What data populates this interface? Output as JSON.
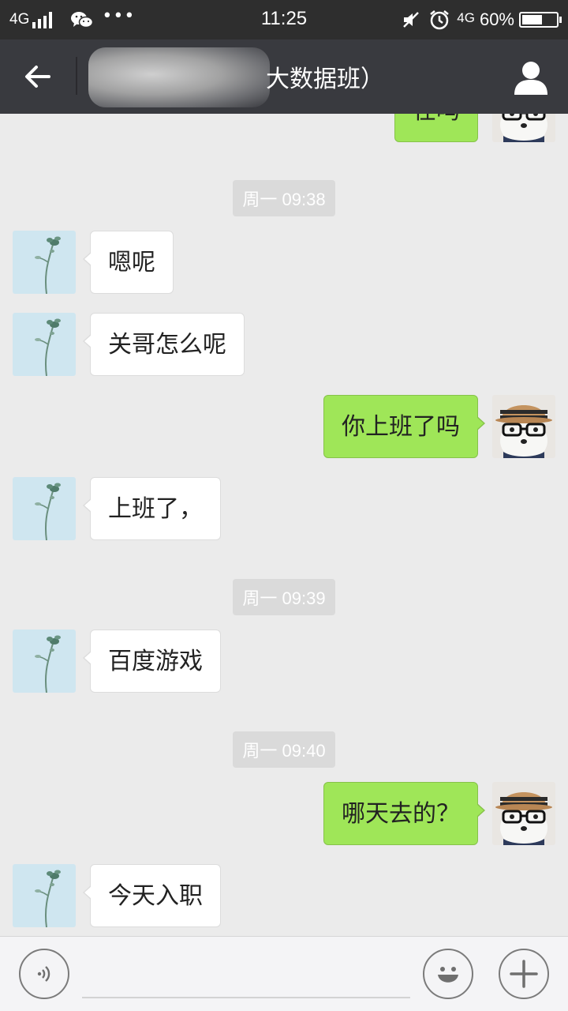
{
  "status_bar": {
    "network_left": "4G",
    "time": "11:25",
    "network_right": "4G",
    "battery_percent_label": "60%",
    "battery_level": 0.6,
    "icons": [
      "signal-icon",
      "wechat-icon",
      "more-dots-icon",
      "mute-icon",
      "alarm-icon",
      "battery-icon"
    ]
  },
  "header": {
    "title": "大数据班）",
    "back_icon": "back-arrow-icon",
    "profile_icon": "profile-icon"
  },
  "chat": {
    "timestamps": [
      "周一 09:38",
      "周一 09:39",
      "周一 09:40"
    ],
    "messages": [
      {
        "side": "right",
        "text": "在吗"
      },
      {
        "side": "left",
        "text": "嗯呢"
      },
      {
        "side": "left",
        "text": "关哥怎么呢"
      },
      {
        "side": "right",
        "text": "你上班了吗"
      },
      {
        "side": "left",
        "text": "上班了，"
      },
      {
        "side": "left",
        "text": "百度游戏"
      },
      {
        "side": "right",
        "text": "哪天去的？"
      },
      {
        "side": "left",
        "text": "今天入职"
      }
    ]
  },
  "input_bar": {
    "value": "",
    "icons": [
      "voice-icon",
      "emoji-icon",
      "plus-icon"
    ]
  },
  "colors": {
    "status_bar_bg": "#2e2e2e",
    "nav_bg": "#393a3f",
    "chat_bg": "#ebebeb",
    "sent_bubble": "#9fe658",
    "received_bubble": "#ffffff",
    "timestamp_bg": "#dadada"
  }
}
